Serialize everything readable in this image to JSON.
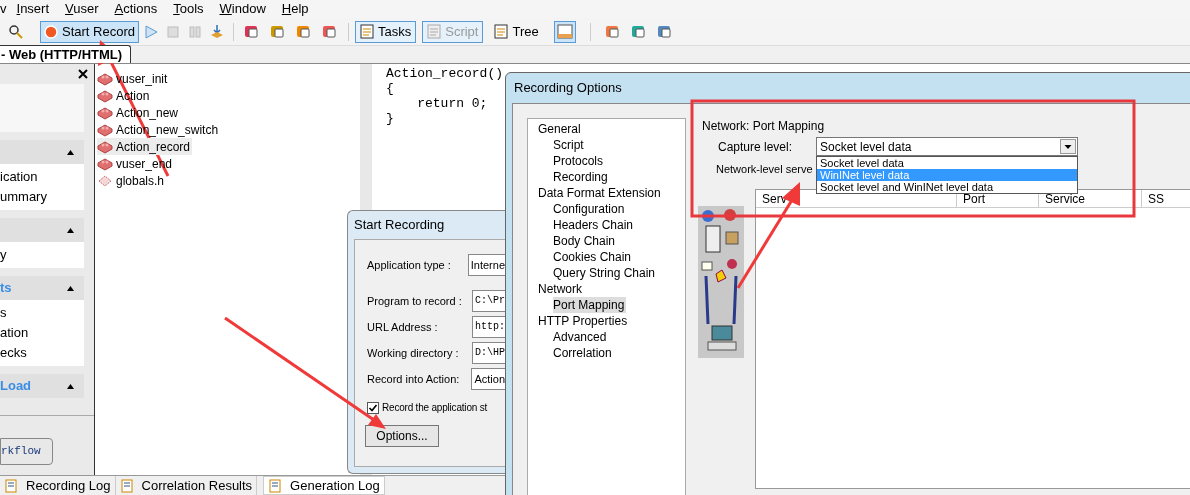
{
  "menu": [
    {
      "label": "v",
      "mnemonic": false
    },
    {
      "label": "Insert",
      "mnemonic": true
    },
    {
      "label": "Vuser",
      "mnemonic": true
    },
    {
      "label": "Actions",
      "mnemonic": true
    },
    {
      "label": "Tools",
      "mnemonic": true
    },
    {
      "label": "Window",
      "mnemonic": true
    },
    {
      "label": "Help",
      "mnemonic": true
    }
  ],
  "toolbar": {
    "record_button": {
      "label": "Start Record",
      "pressed": true
    },
    "view_buttons": [
      {
        "label": "Tasks",
        "pressed": true,
        "disabled": false
      },
      {
        "label": "Script",
        "pressed": true,
        "disabled": true
      },
      {
        "label": "Tree",
        "pressed": false,
        "disabled": false
      }
    ]
  },
  "document_tab": {
    "label": "- Web (HTTP/HTML)"
  },
  "task_pane": {
    "sections": [
      {
        "items": [
          "ication",
          "ummary"
        ]
      },
      {
        "items": [
          "y"
        ]
      },
      {
        "header": "ts",
        "items": [
          "s",
          "ation",
          "ecks"
        ]
      },
      {
        "header": "Load"
      }
    ],
    "workflow_button": "rkflow"
  },
  "files": [
    {
      "name": "vuser_init",
      "kind": "action",
      "selected": false
    },
    {
      "name": "Action",
      "kind": "action",
      "selected": false
    },
    {
      "name": "Action_new",
      "kind": "action",
      "selected": false
    },
    {
      "name": "Action_new_switch",
      "kind": "action",
      "selected": false
    },
    {
      "name": "Action_record",
      "kind": "action",
      "selected": true
    },
    {
      "name": "vuser_end",
      "kind": "action",
      "selected": false
    },
    {
      "name": "globals.h",
      "kind": "header",
      "selected": false
    }
  ],
  "editor": {
    "lines": [
      "Action_record()",
      "{",
      "    return 0;",
      "}"
    ]
  },
  "start_recording": {
    "title": "Start Recording",
    "fields": [
      {
        "label": "Application type :",
        "value": "Interne",
        "kind": "combo"
      },
      {
        "label": "Program to record :",
        "value": "C:\\Pr",
        "kind": "mono"
      },
      {
        "label": "URL Address :",
        "value": "http:",
        "kind": "mono"
      },
      {
        "label": "Working directory :",
        "value": "D:\\HP",
        "kind": "mono"
      },
      {
        "label": "Record into Action:",
        "value": "Action",
        "kind": "combo"
      }
    ],
    "checkbox": {
      "label": "Record the application st",
      "checked": true
    },
    "options_button": "Options..."
  },
  "recording_options": {
    "title": "Recording Options",
    "tree": [
      {
        "label": "General",
        "selected": false,
        "children": [
          {
            "label": "Script",
            "selected": false
          },
          {
            "label": "Protocols",
            "selected": false
          },
          {
            "label": "Recording",
            "selected": false
          }
        ]
      },
      {
        "label": "Data Format Extension",
        "selected": false,
        "children": [
          {
            "label": "Configuration",
            "selected": false
          },
          {
            "label": "Headers Chain",
            "selected": false
          },
          {
            "label": "Body Chain",
            "selected": false
          },
          {
            "label": "Cookies Chain",
            "selected": false
          },
          {
            "label": "Query String Chain",
            "selected": false
          }
        ]
      },
      {
        "label": "Network",
        "selected": false,
        "children": [
          {
            "label": "Port Mapping",
            "selected": true
          }
        ]
      },
      {
        "label": "HTTP Properties",
        "selected": false,
        "children": [
          {
            "label": "Advanced",
            "selected": false
          },
          {
            "label": "Correlation",
            "selected": false
          }
        ]
      }
    ],
    "group_title": "Network: Port Mapping",
    "capture_label": "Capture level:",
    "capture_value": "Socket level data",
    "capture_options": [
      {
        "label": "Socket level data",
        "selected": false
      },
      {
        "label": "WinINet level data",
        "selected": true
      },
      {
        "label": "Socket level and WinINet level data",
        "selected": false
      }
    ],
    "server_label": "Network-level serve",
    "columns": [
      "Serv",
      "Port",
      "Service",
      "SS"
    ]
  },
  "bottom_tabs": [
    {
      "label": "Recording Log",
      "selected": false
    },
    {
      "label": "Correlation Results",
      "selected": false
    },
    {
      "label": "Generation Log",
      "selected": true
    }
  ]
}
